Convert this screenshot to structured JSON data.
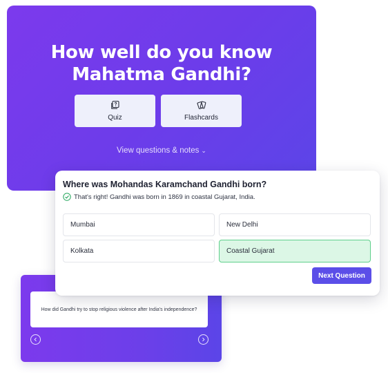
{
  "hero": {
    "title": "How well do you know Mahatma Gandhi?",
    "buttons": {
      "quiz": {
        "label": "Quiz",
        "icon": "question-box-icon"
      },
      "flashcards": {
        "label": "Flashcards",
        "icon": "cards-icon"
      }
    },
    "view_link": "View questions & notes",
    "view_link_icon": "chevron-down-icon"
  },
  "flashcard": {
    "question": "How did Gandhi try to stop religious violence after India's independence?",
    "prev_icon": "chevron-left-icon",
    "next_icon": "chevron-right-icon"
  },
  "quiz": {
    "question": "Where was Mohandas Karamchand Gandhi born?",
    "feedback": "That's right! Gandhi was born in 1869 in coastal Gujarat, India.",
    "feedback_icon": "check-circle-icon",
    "options": [
      {
        "label": "Mumbai",
        "state": "default"
      },
      {
        "label": "New Delhi",
        "state": "default"
      },
      {
        "label": "Kolkata",
        "state": "default"
      },
      {
        "label": "Coastal Gujarat",
        "state": "correct"
      }
    ],
    "next_label": "Next Question"
  },
  "colors": {
    "brand_purple": "#7c3aed",
    "brand_indigo": "#5b45e8",
    "correct_bg": "#dcf7e6",
    "correct_border": "#5ecf8b",
    "success_green": "#22a55a",
    "button_bg": "#5b4ee8"
  }
}
